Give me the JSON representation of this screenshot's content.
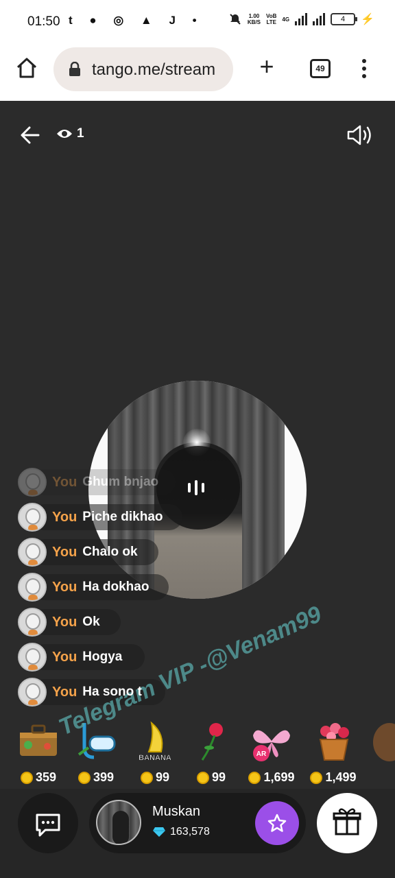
{
  "status_bar": {
    "time": "01:50",
    "left_icons": "t ● ◎ ▲ J •",
    "net_speed": "1.00",
    "net_unit": "KB/S",
    "vo": "VoB",
    "lte": "LTE",
    "net_4g": "4G",
    "battery": "4"
  },
  "browser": {
    "url": "tango.me/stream",
    "tab_count": "49"
  },
  "stream": {
    "viewer_count": "1"
  },
  "chat": [
    {
      "user": "You",
      "message": "Ghum bnjao"
    },
    {
      "user": "You",
      "message": "Piche dikhao"
    },
    {
      "user": "You",
      "message": "Chalo ok"
    },
    {
      "user": "You",
      "message": "Ha dokhao"
    },
    {
      "user": "You",
      "message": "Ok"
    },
    {
      "user": "You",
      "message": "Hogya"
    },
    {
      "user": "You",
      "message": "Ha sono t"
    }
  ],
  "gifts": [
    {
      "name": "suitcase-gift",
      "price": "359"
    },
    {
      "name": "snorkel-gift",
      "price": "399"
    },
    {
      "name": "banana-gift",
      "price": "99",
      "label": "BANANA"
    },
    {
      "name": "rose-gift",
      "price": "99"
    },
    {
      "name": "butterfly-gift",
      "price": "1,699",
      "badge": "AR"
    },
    {
      "name": "flower-basket-gift",
      "price": "1,499"
    }
  ],
  "streamer": {
    "name": "Muskan",
    "diamonds": "163,578"
  },
  "watermark": "Telegram VIP -@Venam99",
  "colors": {
    "background": "#2b2b2b",
    "username": "#f4a24a",
    "star_button": "#9b4fe8",
    "coin": "#f5c518"
  }
}
